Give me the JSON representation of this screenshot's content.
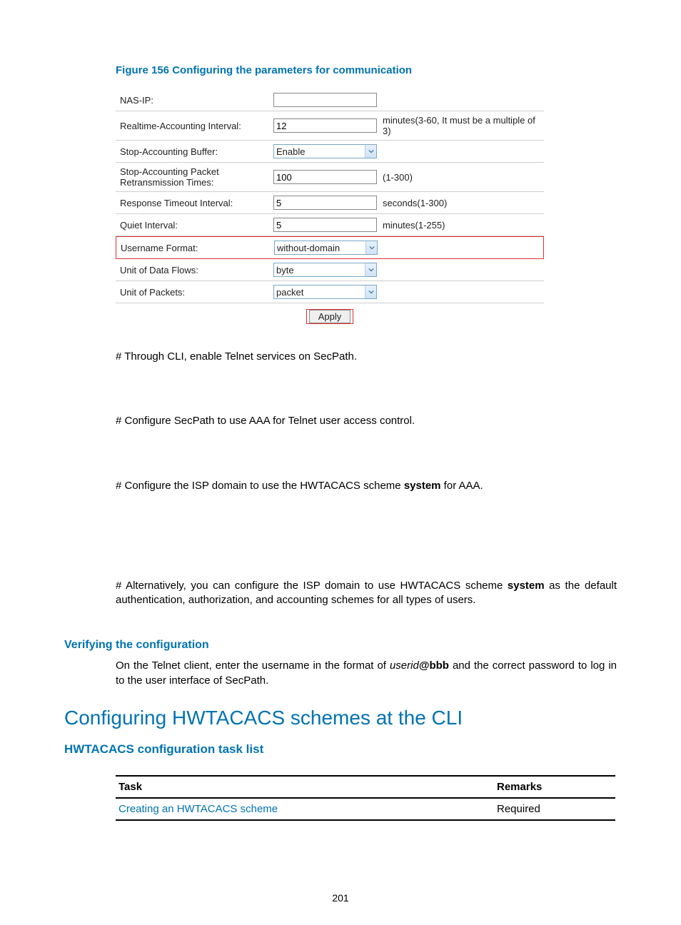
{
  "figure_caption": "Figure 156 Configuring the parameters for communication",
  "form": {
    "rows": [
      {
        "label": "NAS-IP:",
        "type": "text",
        "value": "",
        "hint": ""
      },
      {
        "label": "Realtime-Accounting Interval:",
        "type": "text",
        "value": "12",
        "hint": "minutes(3-60, It must be a multiple of 3)"
      },
      {
        "label": "Stop-Accounting Buffer:",
        "type": "select",
        "value": "Enable",
        "hint": ""
      },
      {
        "label": "Stop-Accounting Packet Retransmission Times:",
        "type": "text",
        "value": "100",
        "hint": "(1-300)"
      },
      {
        "label": "Response Timeout Interval:",
        "type": "text",
        "value": "5",
        "hint": "seconds(1-300)"
      },
      {
        "label": "Quiet Interval:",
        "type": "text",
        "value": "5",
        "hint": "minutes(1-255)"
      },
      {
        "label": "Username Format:",
        "type": "select",
        "value": "without-domain",
        "hint": "",
        "highlight": true
      },
      {
        "label": "Unit of Data Flows:",
        "type": "select",
        "value": "byte",
        "hint": ""
      },
      {
        "label": "Unit of Packets:",
        "type": "select",
        "value": "packet",
        "hint": ""
      }
    ],
    "apply_label": "Apply"
  },
  "para1": "# Through CLI, enable Telnet services on SecPath.",
  "para2": "# Configure SecPath to use AAA for Telnet user access control.",
  "para3_pre": "# Configure the ISP domain to use the HWTACACS scheme ",
  "para3_bold": "system",
  "para3_post": " for AAA.",
  "para4_pre": "# Alternatively, you can configure the ISP domain to use HWTACACS scheme ",
  "para4_bold": "system",
  "para4_post": " as the default authentication, authorization, and accounting schemes for all types of users.",
  "h3_verify": "Verifying the configuration",
  "verify_pre": "On the Telnet client, enter the username in the format of ",
  "verify_italic": "userid",
  "verify_bold": "@bbb",
  "verify_post": " and the correct password to log in to the user interface of SecPath.",
  "h2_cli": "Configuring HWTACACS schemes at the CLI",
  "h3_tasklist": "HWTACACS configuration task list",
  "table": {
    "headers": [
      "Task",
      "Remarks"
    ],
    "row": {
      "task": "Creating an HWTACACS scheme",
      "remarks": "Required"
    }
  },
  "page_number": "201"
}
